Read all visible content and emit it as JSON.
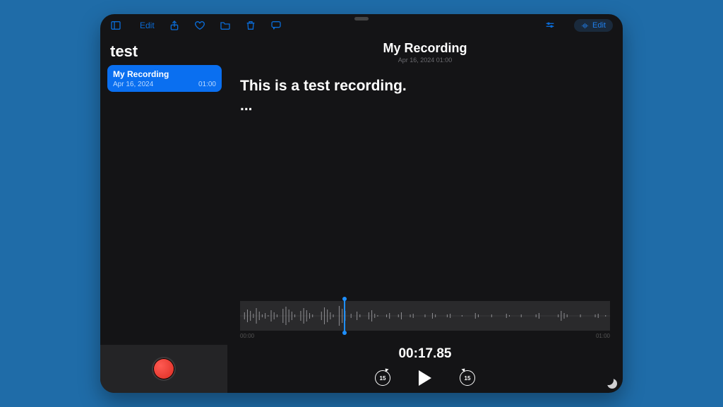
{
  "toolbar": {
    "edit_top": "Edit",
    "edit_pill": "Edit"
  },
  "sidebar": {
    "title": "test",
    "items": [
      {
        "title": "My Recording",
        "date": "Apr 16, 2024",
        "duration": "01:00"
      }
    ]
  },
  "header": {
    "title": "My Recording",
    "subtitle": "Apr 16, 2024  01:00"
  },
  "transcript": {
    "line1": "This is a test recording.",
    "line2": "..."
  },
  "wave": {
    "start_label": "00:00",
    "end_label": "01:00",
    "timecode": "00:17.85",
    "playhead_pct": 28,
    "skip_seconds": "15"
  }
}
